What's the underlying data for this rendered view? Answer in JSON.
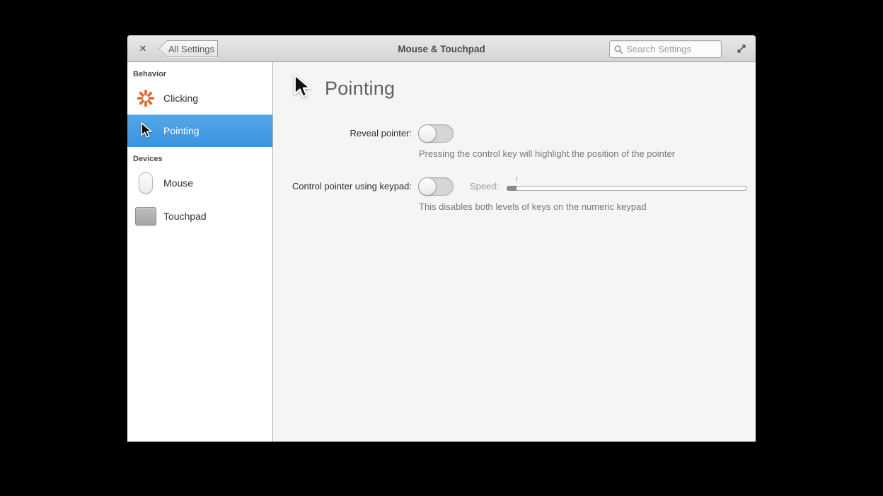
{
  "window": {
    "title": "Mouse & Touchpad",
    "close_glyph": "✕",
    "back_button_label": "All Settings",
    "search_placeholder": "Search Settings"
  },
  "sidebar": {
    "sections": [
      {
        "label": "Behavior",
        "items": [
          {
            "label": "Clicking",
            "icon": "click-burst-icon",
            "selected": false
          },
          {
            "label": "Pointing",
            "icon": "pointer-cursor-icon",
            "selected": true
          }
        ]
      },
      {
        "label": "Devices",
        "items": [
          {
            "label": "Mouse",
            "icon": "mouse-icon",
            "selected": false
          },
          {
            "label": "Touchpad",
            "icon": "touchpad-icon",
            "selected": false
          }
        ]
      }
    ]
  },
  "main": {
    "title": "Pointing",
    "header_icon": "pointer-cursor-icon",
    "settings": [
      {
        "label": "Reveal pointer:",
        "toggle_state": "off",
        "description": "Pressing the control key will highlight the position of the pointer"
      },
      {
        "label": "Control pointer using keypad:",
        "toggle_state": "off",
        "speed_label": "Speed:",
        "speed_enabled": false,
        "slider_fill_percent": 4,
        "description": "This disables both levels of keys on the numeric keypad"
      }
    ]
  },
  "colors": {
    "selection_blue": "#429fe2",
    "accent_orange": "#e2682c",
    "toolbar_top": "#e9e9e8",
    "toolbar_bottom": "#d3d3d1",
    "content_bg": "#f5f5f4",
    "sidebar_bg": "#ffffff"
  }
}
